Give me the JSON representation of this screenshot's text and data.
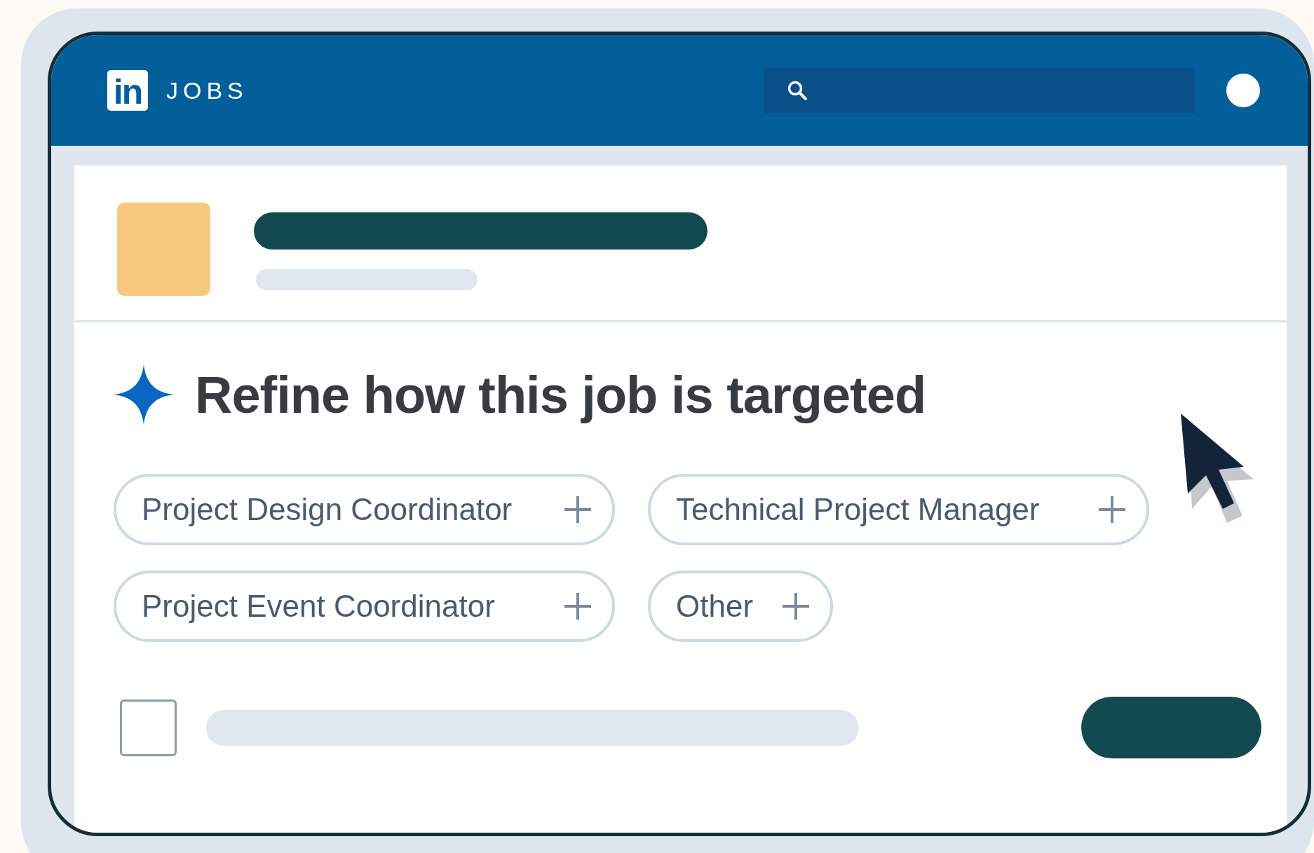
{
  "header": {
    "logo": "in",
    "title": "JOBS"
  },
  "job": {
    "heading": "Refine how this job is targeted",
    "chips": [
      {
        "label": "Project Design Coordinator"
      },
      {
        "label": "Technical Project Manager"
      },
      {
        "label": "Project Event Coordinator"
      },
      {
        "label": "Other"
      }
    ],
    "confirm": {
      "checked": false
    }
  }
}
